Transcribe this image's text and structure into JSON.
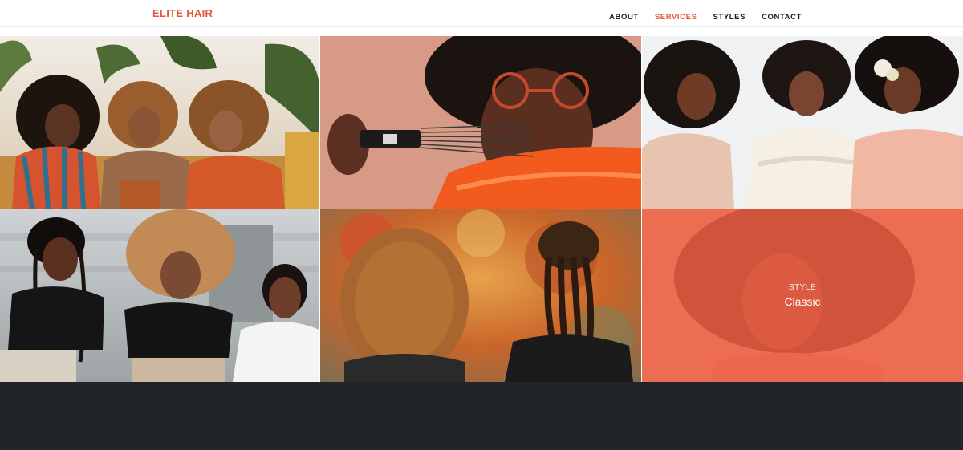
{
  "brand": "ELITE HAIR",
  "nav": {
    "items": [
      {
        "label": "ABOUT",
        "active": false
      },
      {
        "label": "SERVICES",
        "active": true
      },
      {
        "label": "STYLES",
        "active": false
      },
      {
        "label": "CONTACT",
        "active": false
      }
    ]
  },
  "gallery": {
    "hovered": {
      "category": "STYLE",
      "name": "Classic"
    }
  },
  "colors": {
    "accent": "#e05a3a",
    "overlay": "#ec5e42",
    "footer": "#212429",
    "nav_text": "#1f1f1f"
  }
}
